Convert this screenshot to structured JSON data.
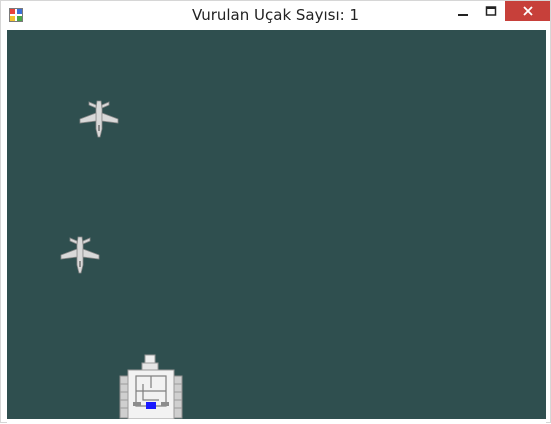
{
  "window": {
    "title": "Vurulan Uçak Sayısı: 1",
    "icons": {
      "app": "app-icon",
      "minimize": "minimize-icon",
      "maximize": "maximize-icon",
      "close": "close-icon"
    },
    "colors": {
      "close_button": "#c7403a",
      "game_background": "#2f4f4f"
    }
  },
  "game": {
    "enemy_planes": [
      {
        "name": "enemy-jet-1",
        "icon": "fighter-jet-icon"
      },
      {
        "name": "enemy-jet-2",
        "icon": "fighter-jet-icon"
      }
    ],
    "player": {
      "name": "player-tank",
      "icon": "tank-icon",
      "accent_color": "#1a1aff"
    }
  }
}
